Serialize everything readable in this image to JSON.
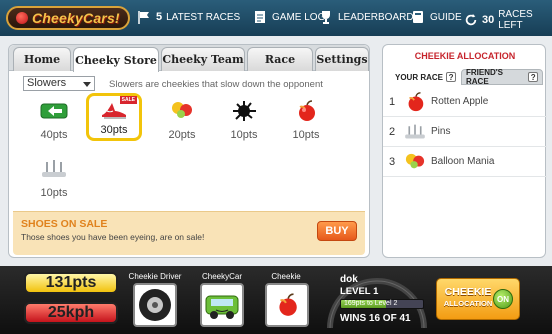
{
  "topbar": {
    "logo": "CheekyCars!",
    "latest_races_count": "5",
    "latest_races_label": "LATEST RACES",
    "game_log": "GAME LOG",
    "leaderboard": "LEADERBOARD",
    "guide": "GUIDE",
    "races_left_count": "30",
    "races_left_label": "RACES LEFT"
  },
  "tabs": [
    "Home",
    "Cheeky Store",
    "Cheeky Team",
    "Race",
    "Settings"
  ],
  "store": {
    "category": "Slowers",
    "hint": "Slowers are cheekies that slow down the opponent",
    "items": [
      {
        "name": "arrow-item",
        "pts": "40pts"
      },
      {
        "name": "shoes-item",
        "pts": "30pts",
        "badge": "SALE"
      },
      {
        "name": "balloon-item",
        "pts": "20pts"
      },
      {
        "name": "ink-splat-item",
        "pts": "10pts"
      },
      {
        "name": "rotten-apple-item",
        "pts": "10pts"
      },
      {
        "name": "pins-item",
        "pts": "10pts"
      }
    ],
    "sale_title": "SHOES ON SALE",
    "sale_text": "Those shoes you have been eyeing, are on sale!",
    "buy": "BUY"
  },
  "allocation": {
    "title": "CHEEKIE ALLOCATION",
    "tab_your": "YOUR RACE",
    "tab_friend": "FRIEND'S RACE",
    "qmark": "?",
    "list": [
      {
        "num": "1",
        "name": "Rotten Apple"
      },
      {
        "num": "2",
        "name": "Pins"
      },
      {
        "num": "3",
        "name": "Balloon Mania"
      }
    ]
  },
  "bottom": {
    "points": "131pts",
    "speed": "25kph",
    "slot_driver": "Cheekie Driver",
    "slot_car": "CheekyCar",
    "slot_cheekie": "Cheekie",
    "user": "dok",
    "level": "LEVEL 1",
    "level_pts": "169pts",
    "level_to": "to Level 2",
    "level_progress": 0.55,
    "wins": "WINS 16 OF 41",
    "alloc_line1": "CHEEKIE",
    "alloc_line2": "ALLOCATION",
    "on": "ON"
  }
}
